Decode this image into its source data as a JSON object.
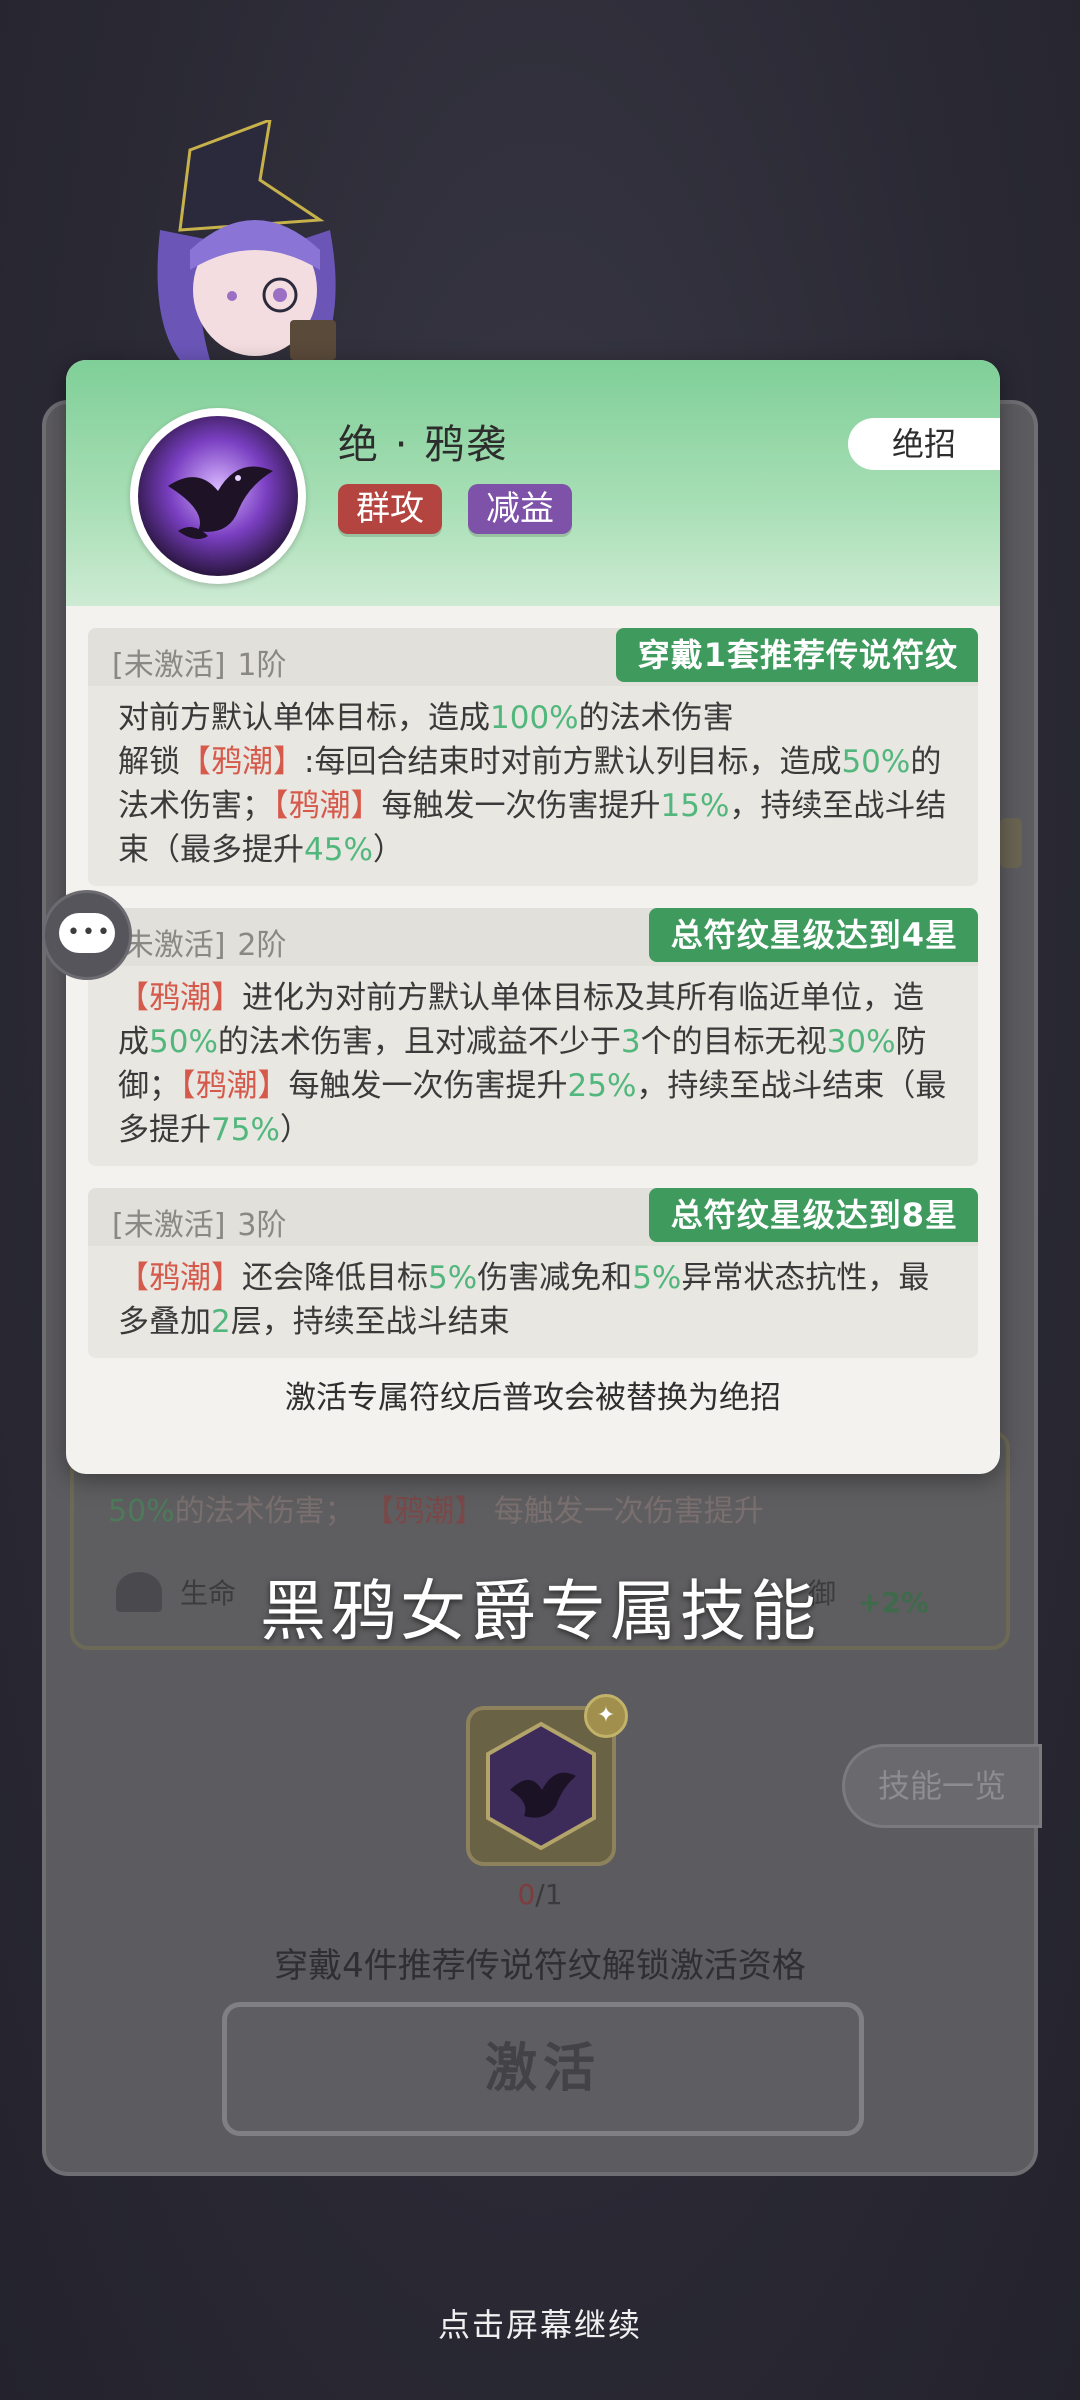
{
  "background": {
    "text_parts": [
      "50%",
      "的法术伤害；",
      "【鸦潮】",
      "每触发一次伤害提升"
    ],
    "life_label": "生命",
    "life_suffix": "御",
    "life_bonus": "+2%"
  },
  "card": {
    "skill_name": "绝 · 鸦袭",
    "tags": [
      "群攻",
      "减益"
    ],
    "ult_badge": "绝招",
    "sections": [
      {
        "status": "[未激活]",
        "level": "1阶",
        "requirement": "穿戴1套推荐传说符纹",
        "text": {
          "p1": "对前方默认单体目标，造成",
          "v1": "100%",
          "p2": "的法术伤害",
          "p3": "解锁",
          "k1": "【鸦潮】",
          "p4": ":每回合结束时对前方默认列目标，造成",
          "v2": "50%",
          "p5": "的法术伤害；",
          "k2": "【鸦潮】",
          "p6": "每触发一次伤害提升",
          "v3": "15%",
          "p7": "，持续至战斗结束（最多提升",
          "v4": "45%",
          "p8": "）"
        }
      },
      {
        "status": "[未激活]",
        "level": "2阶",
        "requirement": "总符纹星级达到4星",
        "text": {
          "k1": "【鸦潮】",
          "p1": "进化为对前方默认单体目标及其所有临近单位，造成",
          "v1": "50%",
          "p2": "的法术伤害，且对减益不少于",
          "v2": "3",
          "p3": "个的目标无视",
          "v3": "30%",
          "p4": "防御；",
          "k2": "【鸦潮】",
          "p5": "每触发一次伤害提升",
          "v4": "25%",
          "p6": "，持续至战斗结束（最多提升",
          "v5": "75%",
          "p7": "）"
        }
      },
      {
        "status": "[未激活]",
        "level": "3阶",
        "requirement": "总符纹星级达到8星",
        "text": {
          "k1": "【鸦潮】",
          "p1": "还会降低目标",
          "v1": "5%",
          "p2": "伤害减免和",
          "v2": "5%",
          "p3": "异常状态抗性，最多叠加",
          "v3": "2",
          "p4": "层，持续至战斗结束"
        }
      }
    ],
    "footer": "激活专属符纹后普攻会被替换为绝招"
  },
  "overlay_title": "黑鸦女爵专属技能",
  "skill_list_button": "技能一览",
  "rune": {
    "count_current": "0",
    "count_total": "/1",
    "unlock_tip": "穿戴4件推荐传说符纹解锁激活资格"
  },
  "activate_button": "激活",
  "continue_hint": "点击屏幕继续",
  "colors": {
    "accent_green": "#3f9a5e",
    "highlight_green": "#52b77d",
    "keyword_red": "#d65a4c",
    "tag_red": "#b4443f",
    "tag_purple": "#7d52a8"
  },
  "icons": [
    "chat-icon",
    "heart-icon",
    "raven-skill-icon",
    "rune-icon"
  ]
}
